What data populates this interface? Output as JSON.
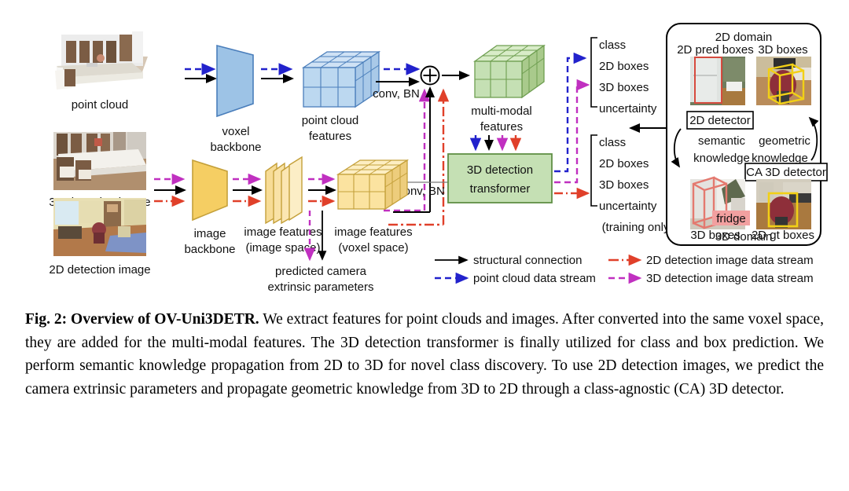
{
  "figure": {
    "title": "Overview of OV-Uni3DETR",
    "inputs": [
      {
        "id": "point-cloud",
        "label": "point cloud"
      },
      {
        "id": "3d-detection-image",
        "label": "3D detection image"
      },
      {
        "id": "2d-detection-image",
        "label": "2D detection image"
      }
    ],
    "blocks": [
      {
        "id": "voxel-backbone",
        "label_line1": "voxel",
        "label_line2": "backbone",
        "color": "#9dc3e6"
      },
      {
        "id": "point-cloud-features",
        "label_line1": "point cloud",
        "label_line2": "features",
        "color": "#bdd7ee"
      },
      {
        "id": "image-backbone",
        "label_line1": "image",
        "label_line2": "backbone",
        "color": "#f5ce63"
      },
      {
        "id": "image-features-image-space",
        "label_line1": "image features",
        "label_line2": "(image space)",
        "color": "#fbdf8f"
      },
      {
        "id": "image-features-voxel-space",
        "label_line1": "image features",
        "label_line2": "(voxel space)",
        "color": "#fbe3a0"
      },
      {
        "id": "multi-modal-features",
        "label_line1": "multi-modal",
        "label_line2": "features",
        "color": "#c5e0b4"
      },
      {
        "id": "3d-detection-transformer",
        "label_line1": "3D detection",
        "label_line2": "transformer",
        "color": "#c5e0b4"
      }
    ],
    "edge_labels": {
      "conv_bn_top": "conv, BN",
      "conv_bn_bottom": "conv, BN",
      "sum_symbol": "+",
      "predicted_camera_line1": "predicted camera",
      "predicted_camera_line2": "extrinsic parameters"
    },
    "outputs": {
      "top_group": [
        "class",
        "2D boxes",
        "3D boxes",
        "uncertainty"
      ],
      "bottom_group": [
        "class",
        "2D boxes",
        "3D boxes",
        "uncertainty"
      ],
      "bottom_note": "(training only)"
    },
    "domain_panel": {
      "top_title": "2D domain",
      "bottom_title": "3D domain",
      "cells": [
        {
          "id": "2d-pred-boxes",
          "label": "2D pred boxes",
          "position": "top-left"
        },
        {
          "id": "3d-boxes-top",
          "label": "3D boxes",
          "position": "top-right"
        },
        {
          "id": "3d-boxes-bottom",
          "label": "3D boxes",
          "position": "bottom-left"
        },
        {
          "id": "2d-gt-boxes",
          "label": "2D gt boxes",
          "position": "bottom-right"
        }
      ],
      "tags": [
        {
          "id": "2d-detector-tag",
          "label": "2D detector"
        },
        {
          "id": "ca-3d-detector-tag",
          "label": "CA 3D detector"
        }
      ],
      "knowledge": [
        {
          "id": "semantic-knowledge",
          "line1": "semantic",
          "line2": "knowledge"
        },
        {
          "id": "geometric-knowledge",
          "line1": "geometric",
          "line2": "knowledge"
        }
      ],
      "fridge_badge": "fridge"
    },
    "legend": [
      {
        "id": "structural-connection",
        "label": "structural connection",
        "color": "#000000",
        "style": "solid"
      },
      {
        "id": "point-cloud-data-stream",
        "label": "point cloud data stream",
        "color": "#2222cc",
        "style": "dashed"
      },
      {
        "id": "2d-detection-image-data-stream",
        "label": "2D detection image data stream",
        "color": "#e0402a",
        "style": "dashdot"
      },
      {
        "id": "3d-detection-image-data-stream",
        "label": "3D detection image data stream",
        "color": "#c030c0",
        "style": "dashed"
      }
    ]
  },
  "caption": {
    "bold_prefix": "Fig. 2: Overview of OV-Uni3DETR.",
    "body": " We extract features for point clouds and images. After converted into the same voxel space, they are added for the multi-modal features. The 3D detection transformer is finally utilized for class and box prediction. We perform semantic knowledge propagation from 2D to 3D for novel class discovery. To use 2D detection images, we predict the camera extrinsic parameters and propagate geometric knowledge from 3D to 2D through a class-agnostic (CA) 3D detector."
  },
  "colors": {
    "blue_stream": "#2222cc",
    "magenta_stream": "#c030c0",
    "red_stream": "#e0402a",
    "black": "#000000",
    "green_block": "#c5e0b4",
    "blue_block": "#9dc3e6",
    "yellow_block": "#f5ce63"
  }
}
